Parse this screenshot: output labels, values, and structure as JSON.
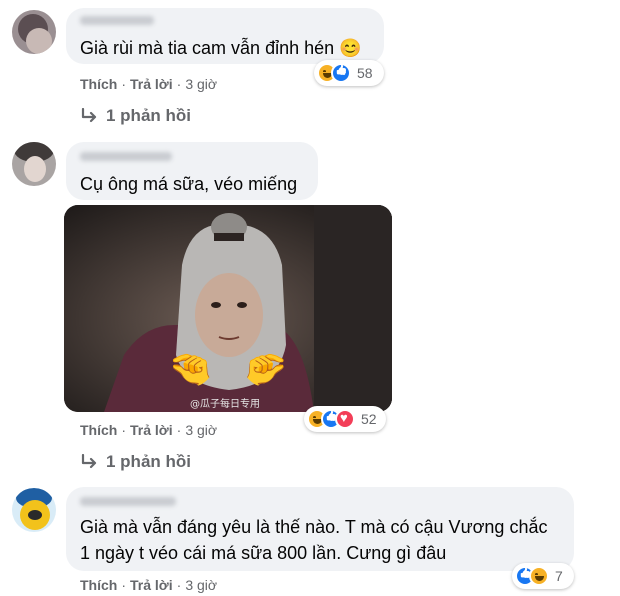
{
  "comments": [
    {
      "text": "Già rùi mà tia cam vẫn đỉnh hén",
      "emoji": "😊",
      "actions": {
        "like": "Thích",
        "reply": "Trả lời",
        "time": "3 giờ"
      },
      "reactions": {
        "types": [
          "haha",
          "like"
        ],
        "count": "58"
      },
      "replies": "1 phản hồi"
    },
    {
      "text": "Cụ ông má sữa, véo miếng",
      "image": {
        "watermark": "@瓜子每日专用",
        "hands": "🤏"
      },
      "actions": {
        "like": "Thích",
        "reply": "Trả lời",
        "time": "3 giờ"
      },
      "reactions": {
        "types": [
          "haha",
          "like",
          "love"
        ],
        "count": "52"
      },
      "replies": "1 phản hồi"
    },
    {
      "text_line1": "Già mà vẫn đáng yêu là thế nào. T mà có cậu Vương chắc",
      "text_line2": "1 ngày t véo cái má sữa 800 lần. Cưng gì đâu",
      "actions": {
        "like": "Thích",
        "reply": "Trả lời",
        "time": "3 giờ"
      },
      "reactions": {
        "types": [
          "like",
          "haha"
        ],
        "count": "7"
      }
    }
  ],
  "colors": {
    "bubble": "#f0f2f5",
    "muted": "#65676b",
    "haha": "#f7b125",
    "like": "#1877f2",
    "love": "#f33e58"
  }
}
